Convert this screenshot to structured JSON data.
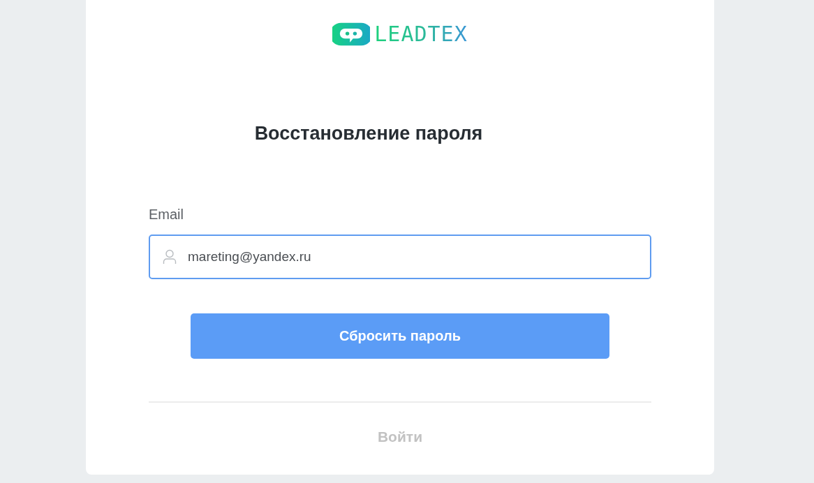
{
  "logo": {
    "text": "LEADTEX"
  },
  "title": "Восстановление пароля",
  "email_field": {
    "label": "Email",
    "value": "mareting@yandex.ru"
  },
  "reset_button": "Сбросить пароль",
  "login_link": "Войти"
}
